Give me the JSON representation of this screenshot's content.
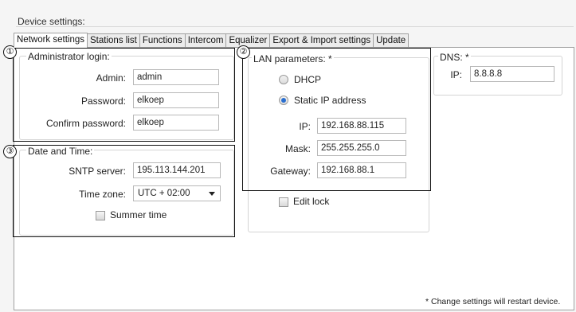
{
  "header": {
    "title": "Device settings:"
  },
  "tabs": [
    {
      "label": "Network settings",
      "active": true
    },
    {
      "label": "Stations list"
    },
    {
      "label": "Functions"
    },
    {
      "label": "Intercom"
    },
    {
      "label": "Equalizer"
    },
    {
      "label": "Export & Import settings"
    },
    {
      "label": "Update"
    }
  ],
  "callouts": {
    "c1": "①",
    "c2": "②",
    "c3": "③"
  },
  "admin": {
    "title": "Administrator login:",
    "admin_label": "Admin:",
    "admin_value": "admin",
    "password_label": "Password:",
    "password_value": "elkoep",
    "confirm_label": "Confirm password:",
    "confirm_value": "elkoep"
  },
  "datetime": {
    "title": "Date and Time:",
    "sntp_label": "SNTP server:",
    "sntp_value": "195.113.144.201",
    "tz_label": "Time zone:",
    "tz_value": "UTC + 02:00",
    "summer_label": "Summer time",
    "summer_checked": false
  },
  "lan": {
    "title": "LAN parameters: *",
    "dhcp_label": "DHCP",
    "dhcp_checked": false,
    "static_label": "Static IP address",
    "static_checked": true,
    "ip_label": "IP:",
    "ip_value": "192.168.88.115",
    "mask_label": "Mask:",
    "mask_value": "255.255.255.0",
    "gateway_label": "Gateway:",
    "gateway_value": "192.168.88.1",
    "edit_lock_label": "Edit lock",
    "edit_lock_checked": false
  },
  "dns": {
    "title": "DNS: *",
    "ip_label": "IP:",
    "ip_value": "8.8.8.8"
  },
  "footnote": "* Change settings will restart device.",
  "colors": {
    "radio_selected": "#2a6fd0",
    "callout_border": "#111111",
    "panel_border": "#a0a0a0"
  }
}
